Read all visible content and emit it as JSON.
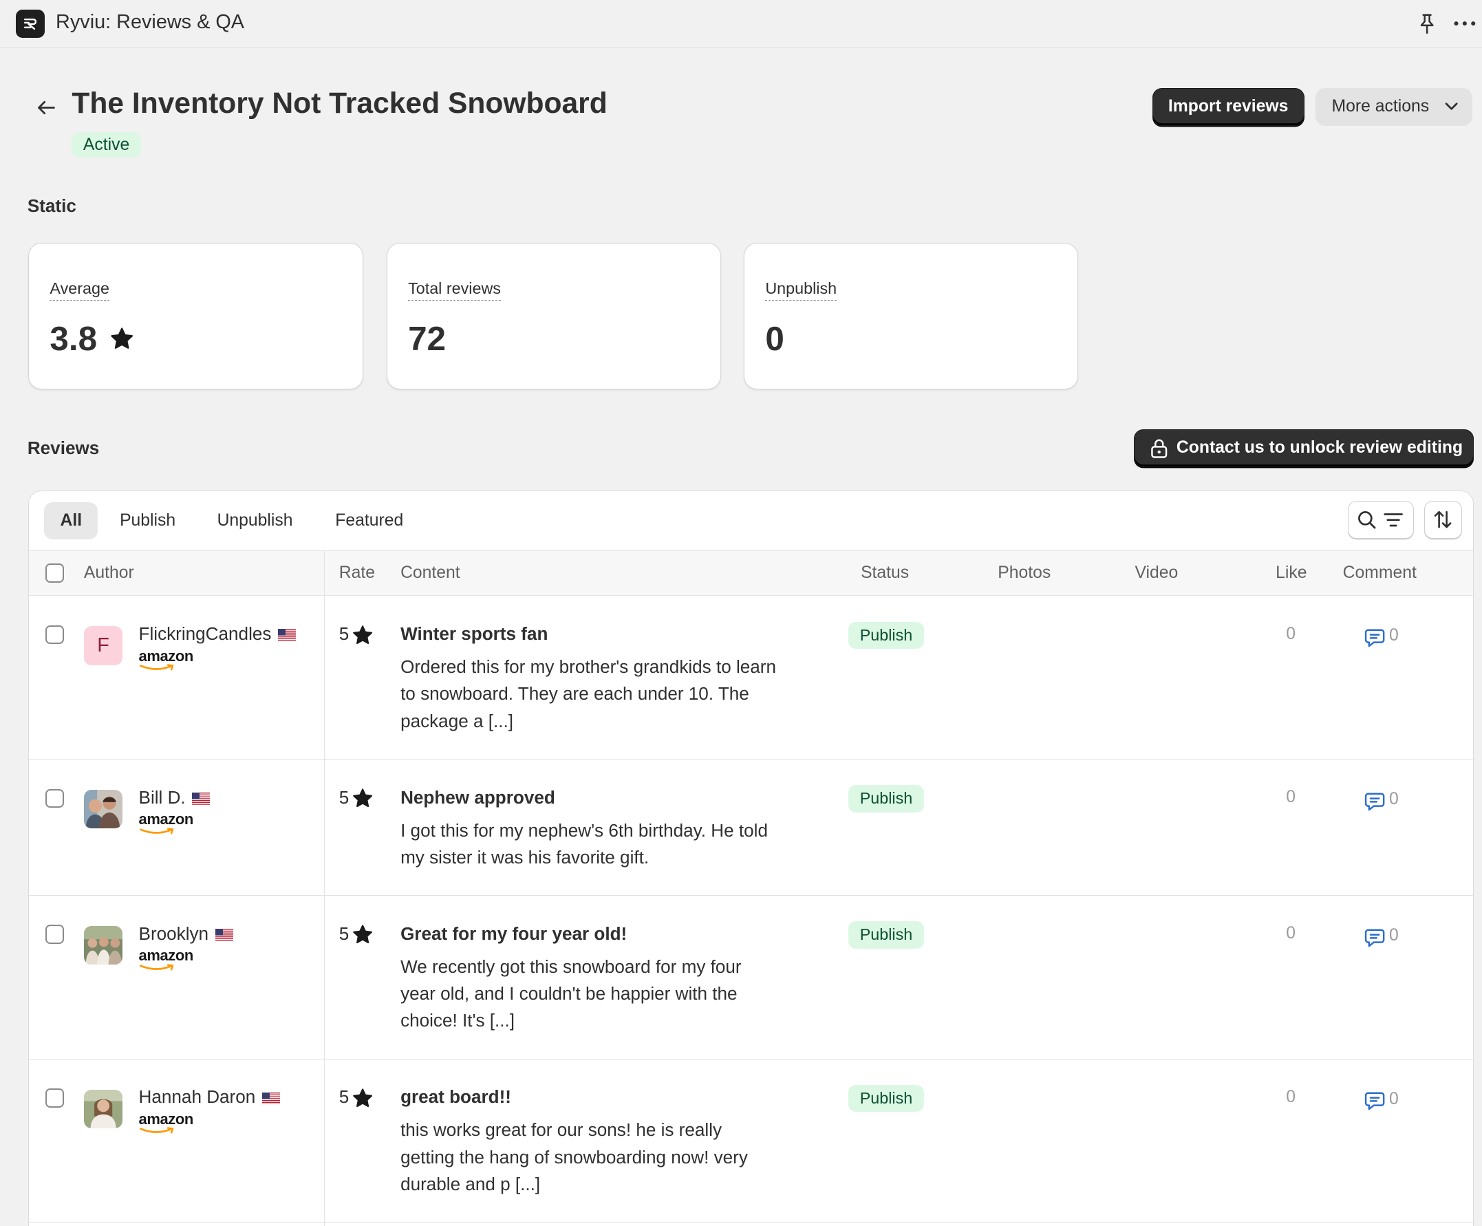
{
  "app": {
    "title": "Ryviu: Reviews & QA"
  },
  "header": {
    "title": "The Inventory Not Tracked Snowboard",
    "status": "Active",
    "import_label": "Import reviews",
    "more_actions_label": "More actions"
  },
  "static": {
    "heading": "Static",
    "cards": [
      {
        "label": "Average",
        "value": "3.8"
      },
      {
        "label": "Total reviews",
        "value": "72"
      },
      {
        "label": "Unpublish",
        "value": "0"
      }
    ]
  },
  "reviews": {
    "heading": "Reviews",
    "unlock_label": "Contact us to unlock review editing",
    "tabs": [
      "All",
      "Publish",
      "Unpublish",
      "Featured"
    ],
    "columns": {
      "author": "Author",
      "rate": "Rate",
      "content": "Content",
      "status": "Status",
      "photos": "Photos",
      "video": "Video",
      "like": "Like",
      "comment": "Comment"
    },
    "rows": [
      {
        "author": "FlickringCandles",
        "avatar_letter": "F",
        "source": "amazon",
        "rate": "5",
        "title": "Winter sports fan",
        "body": "Ordered this for my brother's grandkids to learn to snowboard. They are each under 10. The package a [...]",
        "status": "Publish",
        "likes": "0",
        "comments": "0"
      },
      {
        "author": "Bill D.",
        "source": "amazon",
        "rate": "5",
        "title": "Nephew approved",
        "body": "I got this for my nephew's 6th birthday. He told my sister it was his favorite gift.",
        "status": "Publish",
        "likes": "0",
        "comments": "0"
      },
      {
        "author": "Brooklyn",
        "source": "amazon",
        "rate": "5",
        "title": "Great for my four year old!",
        "body": "We recently got this snowboard for my four year old, and I couldn't be happier with the choice! It's [...]",
        "status": "Publish",
        "likes": "0",
        "comments": "0"
      },
      {
        "author": "Hannah Daron",
        "source": "amazon",
        "rate": "5",
        "title": "great board!!",
        "body": "this works great for our sons! he is really getting the hang of snowboarding now! very durable and p [...]",
        "status": "Publish",
        "likes": "0",
        "comments": "0"
      }
    ]
  },
  "colors": {
    "page_bg": "#f1f1f1",
    "primary_button": "#303030",
    "success_badge_bg": "#dcf8e5",
    "success_badge_text": "#0c5132",
    "comment_icon": "#2c6ecb",
    "amazon_smile": "#ff9900"
  },
  "icons": {
    "app_logo": "ryviu-logo-icon",
    "pin": "pin-icon",
    "more": "horizontal-dots-icon",
    "back": "arrow-left-icon",
    "chevron": "chevron-down-icon",
    "star": "star-icon",
    "lock": "lock-icon",
    "search": "search-icon",
    "filter": "filter-icon",
    "sort": "sort-icon",
    "comment": "comment-icon",
    "flag": "us-flag-icon"
  }
}
